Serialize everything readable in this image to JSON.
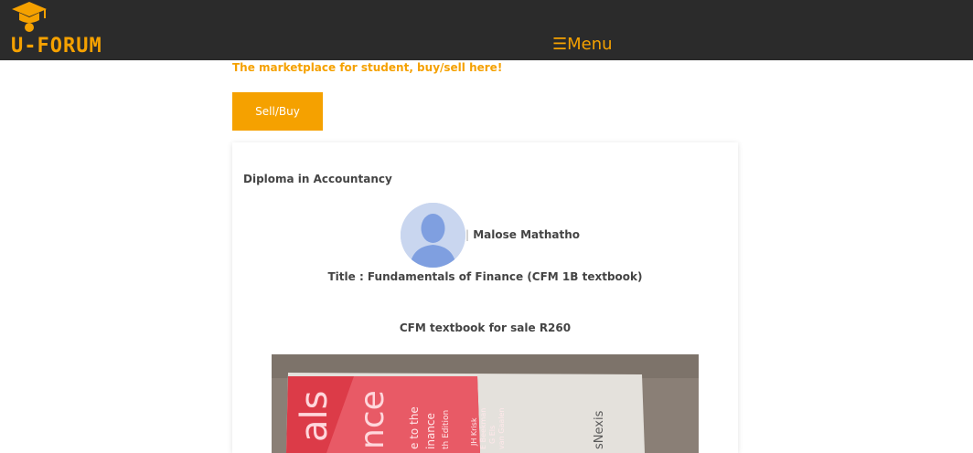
{
  "header": {
    "logo_text": "U-FORUM",
    "menu_label": "☰Menu"
  },
  "marketplace": {
    "tagline": "The marketplace for student, buy/sell here!",
    "sell_buy_label": "Sell/Buy"
  },
  "post": {
    "category": "Diploma in Accountancy",
    "author": "Malose Mathatho",
    "title": "Title : Fundamentals of Finance (CFM 1B textbook)",
    "description": "CFM textbook for sale R260"
  },
  "colors": {
    "accent": "#f5a100",
    "topbar": "#2b2b2b"
  }
}
